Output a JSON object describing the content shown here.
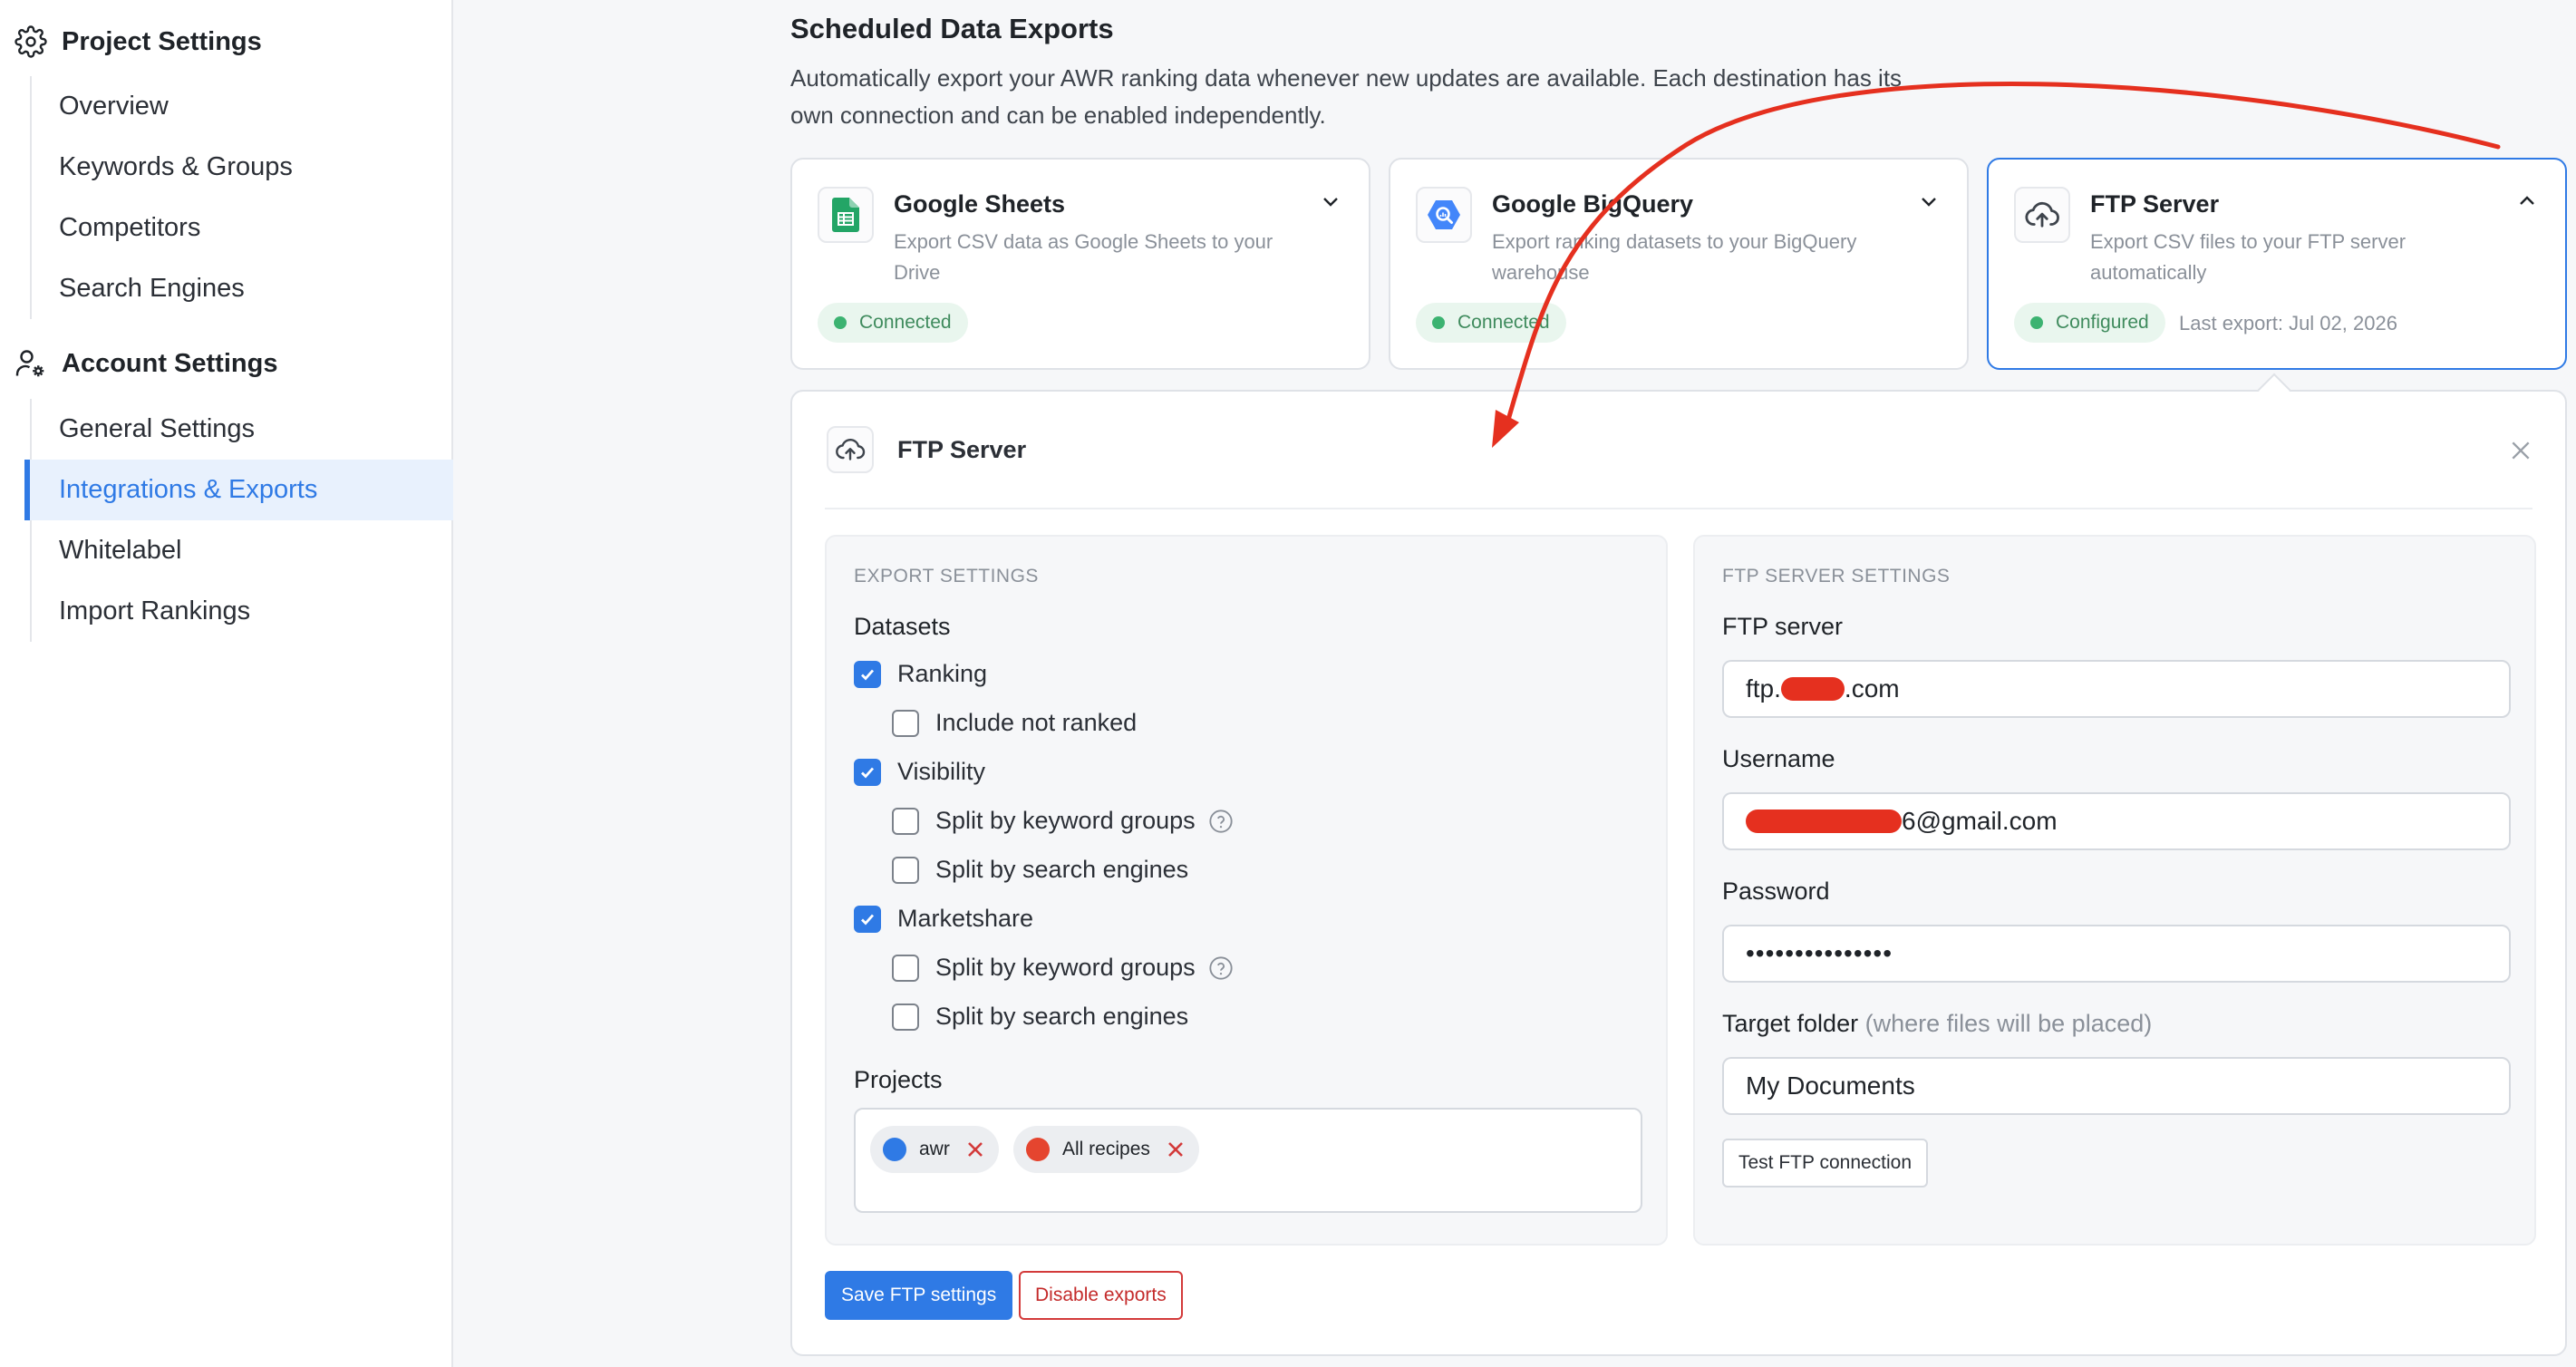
{
  "sidebar": {
    "project_settings_label": "Project Settings",
    "project_items": [
      {
        "label": "Overview"
      },
      {
        "label": "Keywords & Groups"
      },
      {
        "label": "Competitors"
      },
      {
        "label": "Search Engines"
      }
    ],
    "account_settings_label": "Account Settings",
    "account_items": [
      {
        "label": "General Settings"
      },
      {
        "label": "Integrations & Exports",
        "active": true
      },
      {
        "label": "Whitelabel"
      },
      {
        "label": "Import Rankings"
      }
    ]
  },
  "main": {
    "title": "Scheduled Data Exports",
    "description": "Automatically export your AWR ranking data whenever new updates are available. Each destination has its own connection and can be enabled independently."
  },
  "destinations": [
    {
      "name": "Google Sheets",
      "description": "Export CSV data as Google Sheets to your Drive",
      "status": "Connected",
      "icon": "google-sheets-icon",
      "expanded": false
    },
    {
      "name": "Google BigQuery",
      "description": "Export ranking datasets to your BigQuery warehouse",
      "status": "Connected",
      "icon": "bigquery-icon",
      "expanded": false
    },
    {
      "name": "FTP Server",
      "description": "Export CSV files to your FTP server automatically",
      "status": "Configured",
      "last_export": "Last export: Jul 02, 2026",
      "icon": "cloud-upload-icon",
      "expanded": true
    }
  ],
  "panel": {
    "title": "FTP Server",
    "export_settings": {
      "section_title": "EXPORT SETTINGS",
      "datasets_label": "Datasets",
      "options": [
        {
          "label": "Ranking",
          "checked": true
        },
        {
          "label": "Include not ranked",
          "checked": false
        },
        {
          "label": "Visibility",
          "checked": true
        },
        {
          "label": "Split by keyword groups",
          "checked": false
        },
        {
          "label": "Split by search engines",
          "checked": false
        },
        {
          "label": "Marketshare",
          "checked": true
        },
        {
          "label": "Split by keyword groups",
          "checked": false
        },
        {
          "label": "Split by search engines",
          "checked": false
        }
      ],
      "projects_label": "Projects",
      "projects": [
        {
          "name": "awr",
          "color": "#2f7ae5"
        },
        {
          "name": "All recipes",
          "color": "#e5452f"
        }
      ]
    },
    "ftp_settings": {
      "section_title": "FTP SERVER SETTINGS",
      "server_label": "FTP server",
      "server_prefix": "ftp.",
      "server_suffix": ".com",
      "username_label": "Username",
      "username_suffix": "6@gmail.com",
      "password_label": "Password",
      "password_mask": "•••••••••••••••",
      "folder_label": "Target folder",
      "folder_hint": "(where files will be placed)",
      "folder_value": "My Documents",
      "test_button": "Test FTP connection"
    },
    "save_button": "Save FTP settings",
    "disable_button": "Disable exports"
  },
  "colors": {
    "accent": "#2f7ae5",
    "danger": "#c42b2b",
    "annotation": "#e5301f",
    "success": "#3cb371"
  }
}
